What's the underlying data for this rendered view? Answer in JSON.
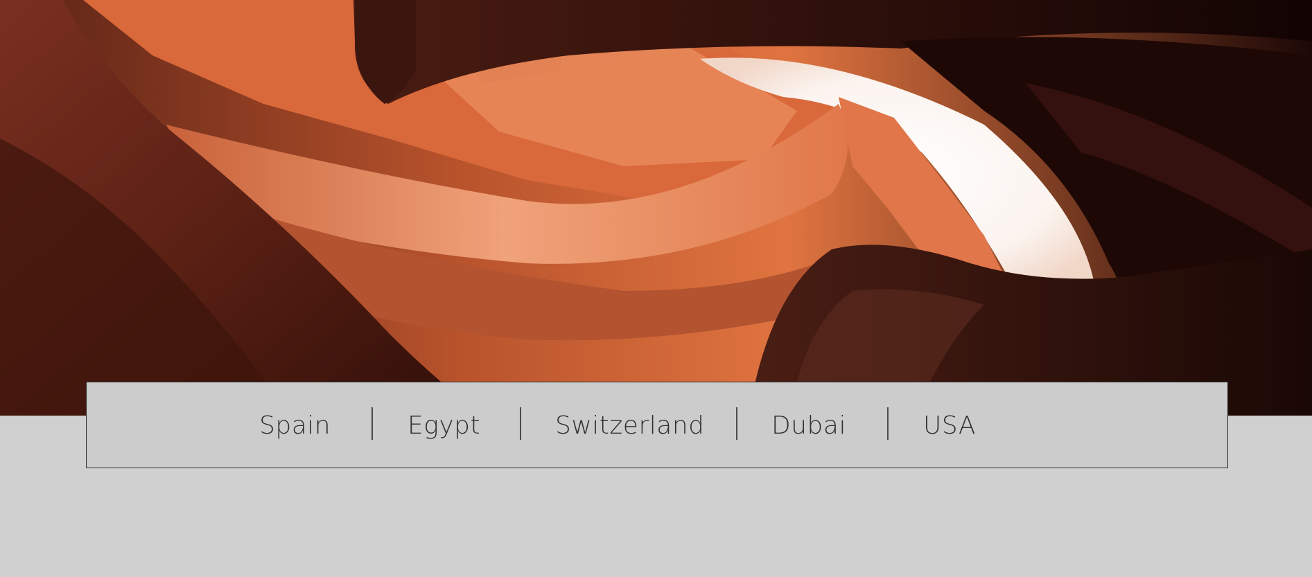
{
  "hero": {
    "image": "antelope-canyon-photo"
  },
  "nav": {
    "items": [
      {
        "label": "Spain"
      },
      {
        "label": "Egypt"
      },
      {
        "label": "Switzerland"
      },
      {
        "label": "Dubai"
      },
      {
        "label": "USA"
      }
    ]
  },
  "colors": {
    "page_background": "#d0d0d0",
    "nav_background": "#cccccc",
    "nav_border": "#2a2a2a",
    "nav_text": "#2f2f2f",
    "rock_orange": "#e06a3a",
    "rock_dark": "#3a140c"
  }
}
